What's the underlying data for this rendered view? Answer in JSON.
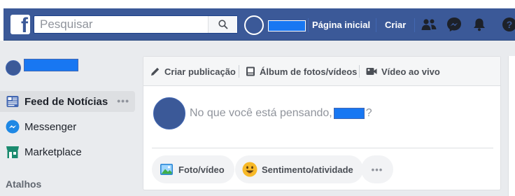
{
  "topbar": {
    "logo_letter": "f",
    "search": {
      "placeholder": "Pesquisar",
      "value": ""
    },
    "nav": {
      "home_label": "Página inicial",
      "create_label": "Criar"
    }
  },
  "sidebar": {
    "items": [
      {
        "label": "Feed de Notícias",
        "icon": "news-feed-icon",
        "active": true,
        "more": "•••"
      },
      {
        "label": "Messenger",
        "icon": "messenger-icon"
      },
      {
        "label": "Marketplace",
        "icon": "marketplace-icon"
      }
    ],
    "shortcuts_heading": "Atalhos"
  },
  "composer": {
    "tabs": [
      {
        "label": "Criar publicação",
        "icon": "pencil-icon"
      },
      {
        "label": "Álbum de fotos/vídeos",
        "icon": "album-icon"
      },
      {
        "label": "Vídeo ao vivo",
        "icon": "live-video-icon"
      }
    ],
    "prompt_prefix": "No que você está pensando,",
    "prompt_suffix": "?",
    "actions": [
      {
        "label": "Foto/vídeo",
        "icon": "photo-icon"
      },
      {
        "label": "Sentimento/atividade",
        "icon": "emoji-icon"
      },
      {
        "label": "•••",
        "icon": "more-icon"
      }
    ]
  },
  "colors": {
    "brand_blue": "#3b5998",
    "redaction_blue": "#1877f2",
    "page_bg": "#e9ebee"
  }
}
